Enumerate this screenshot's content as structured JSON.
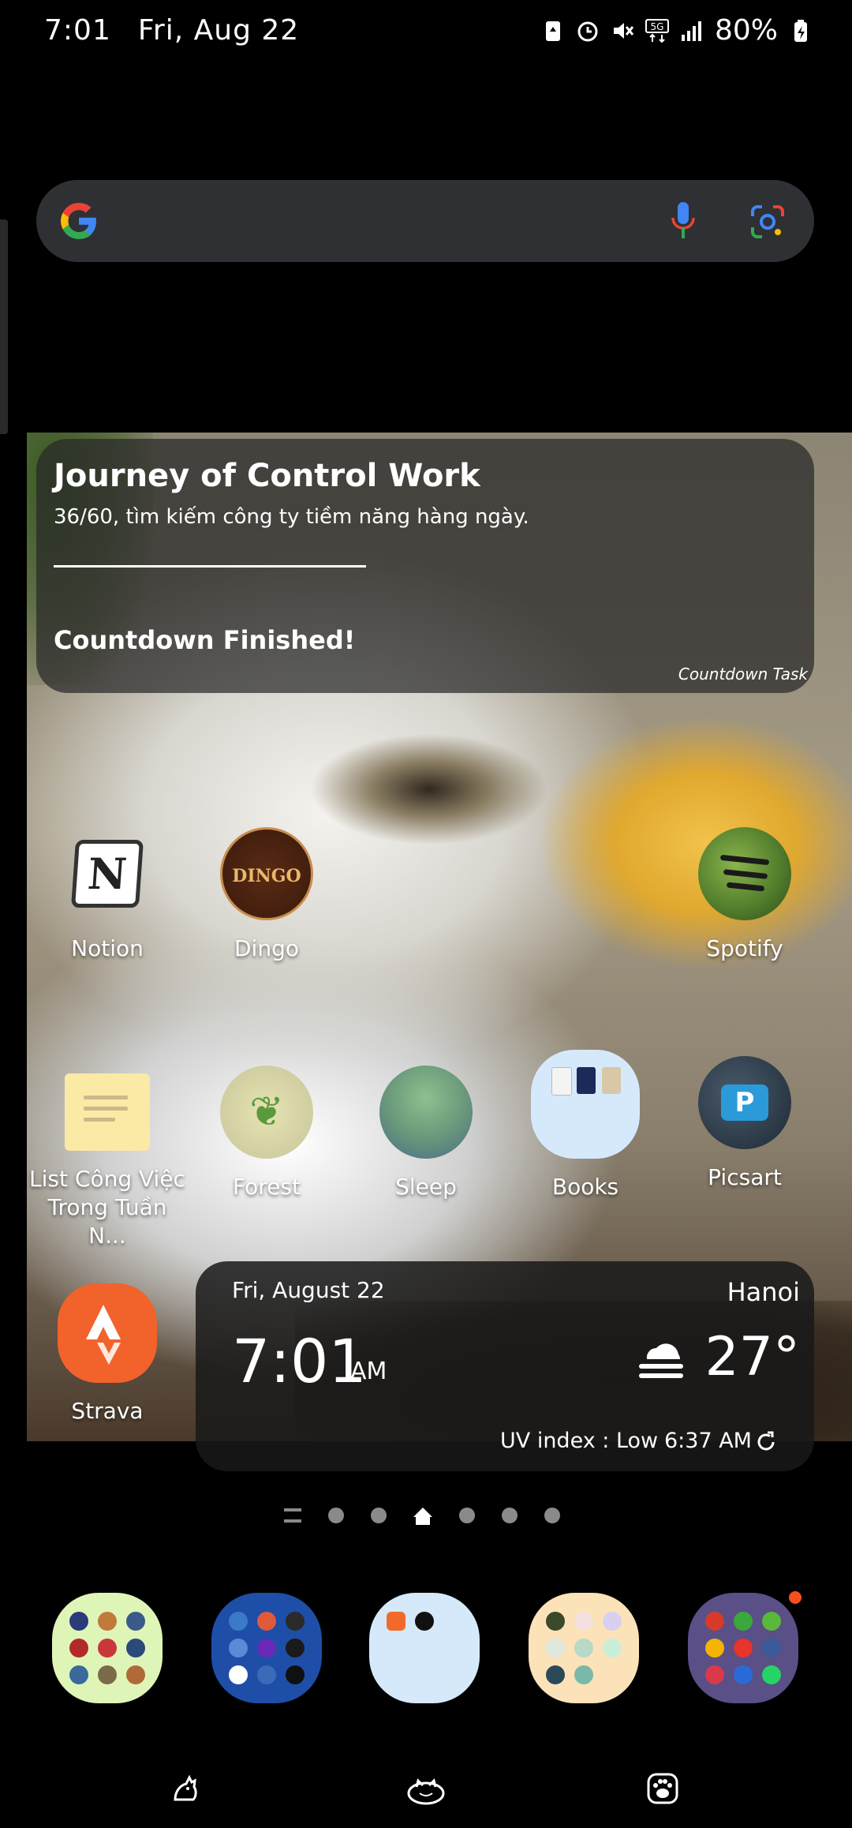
{
  "status_bar": {
    "time": "7:01",
    "date": "Fri, Aug 22",
    "battery": "80%",
    "icons": [
      "battery-saver-icon",
      "alarm-icon",
      "mute-icon",
      "5g-icon",
      "signal-icon",
      "battery-icon"
    ]
  },
  "search_bar": {
    "icons": [
      "google-logo-icon",
      "microphone-icon",
      "google-lens-icon"
    ]
  },
  "countdown_widget": {
    "title": "Journey of Control Work",
    "subtitle": "36/60, tìm kiếm công ty tiềm năng hàng ngày.",
    "status": "Countdown Finished!",
    "brand": "Countdown Task"
  },
  "apps": {
    "row1": [
      {
        "label": "Notion",
        "icon": "notion-icon"
      },
      {
        "label": "Dingo",
        "icon": "dingo-icon",
        "icon_text": "DINGO"
      },
      {
        "label": "Spotify",
        "icon": "spotify-icon"
      }
    ],
    "row2": [
      {
        "label": "List Công Việc Trong Tuần N...",
        "icon": "memo-icon"
      },
      {
        "label": "Forest",
        "icon": "forest-icon"
      },
      {
        "label": "Sleep",
        "icon": "sleep-icon"
      },
      {
        "label": "Books",
        "icon": "books-folder-icon"
      },
      {
        "label": "Picsart",
        "icon": "picsart-icon"
      }
    ],
    "row3": [
      {
        "label": "Strava",
        "icon": "strava-icon"
      }
    ]
  },
  "clock_weather_widget": {
    "date": "Fri, August 22",
    "time": "7:01",
    "ampm": "AM",
    "city": "Hanoi",
    "temperature": "27°",
    "condition_icon": "fog-cloud-icon",
    "uv_index": "UV index : Low",
    "updated": "6:37 AM"
  },
  "page_indicator": {
    "current": "home",
    "dots": [
      "menu",
      "dot",
      "dot",
      "home",
      "dot",
      "dot",
      "dot"
    ]
  },
  "dock": {
    "folders": [
      {
        "name": "folder-1",
        "color": "#dff5b8"
      },
      {
        "name": "folder-2",
        "color": "#1e4ea8"
      },
      {
        "name": "folder-3",
        "color": "#d5e9fb"
      },
      {
        "name": "folder-4",
        "color": "#fbe2b8"
      },
      {
        "name": "folder-5",
        "color": "#5a4f86",
        "has_notification": true
      }
    ]
  },
  "nav_bar": {
    "icons": [
      "recents-cat-icon",
      "home-cat-icon",
      "back-paw-icon"
    ]
  },
  "colors": {
    "search_bg": "#2e3034",
    "widget_bg": "rgba(40,40,40,.72)",
    "strava_orange": "#f2622b",
    "notification": "#f4511e"
  }
}
